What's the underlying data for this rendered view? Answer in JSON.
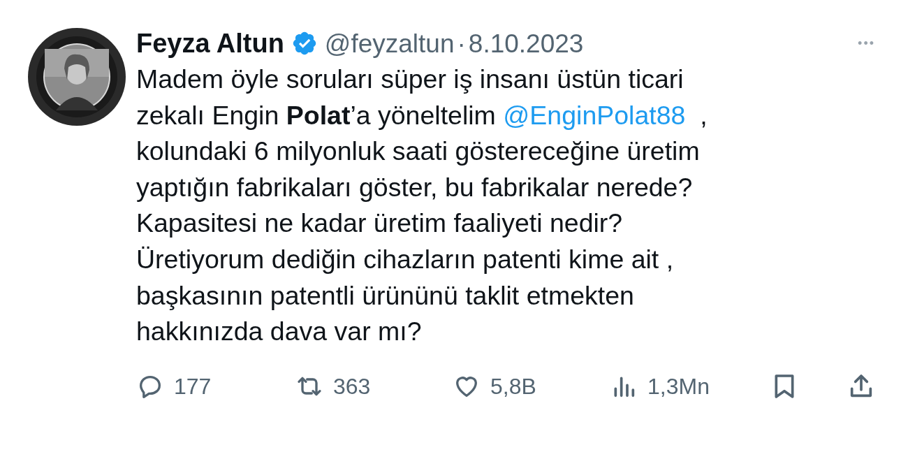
{
  "author": {
    "name": "Feyza Altun",
    "verified": true,
    "handle": "@feyzaltun",
    "separator": "·",
    "date": "8.10.2023"
  },
  "more": "•••",
  "body": [
    [
      {
        "text": "Madem öyle soruları süper iş insanı üstün ticari"
      }
    ],
    [
      {
        "text": "zekalı Engin **Polat**’a yöneltelim "
      },
      {
        "link": "@EnginPolat88"
      },
      {
        "text": "  ,"
      }
    ],
    [
      {
        "text": "kolundaki 6 milyonluk saati göstereceğine üretim"
      }
    ],
    [
      {
        "text": "yaptığın fabrikaları göster, bu fabrikalar nerede?"
      }
    ],
    [
      {
        "text": "Kapasitesi ne kadar üretim faaliyeti nedir?"
      }
    ],
    [
      {
        "text": "Üretiyorum dediğin cihazların patenti kime ait ,"
      }
    ],
    [
      {
        "text": "başkasının patentli ürününü taklit etmekten"
      }
    ],
    [
      {
        "text": "hakkınızda dava var mı?"
      }
    ]
  ],
  "actions": [
    {
      "kind": "reply",
      "count": "177"
    },
    {
      "kind": "repost",
      "count": "363"
    },
    {
      "kind": "like",
      "count": "5,8B"
    },
    {
      "kind": "views",
      "count": "1,3Mn"
    },
    {
      "kind": "bookmark"
    },
    {
      "kind": "share"
    }
  ]
}
